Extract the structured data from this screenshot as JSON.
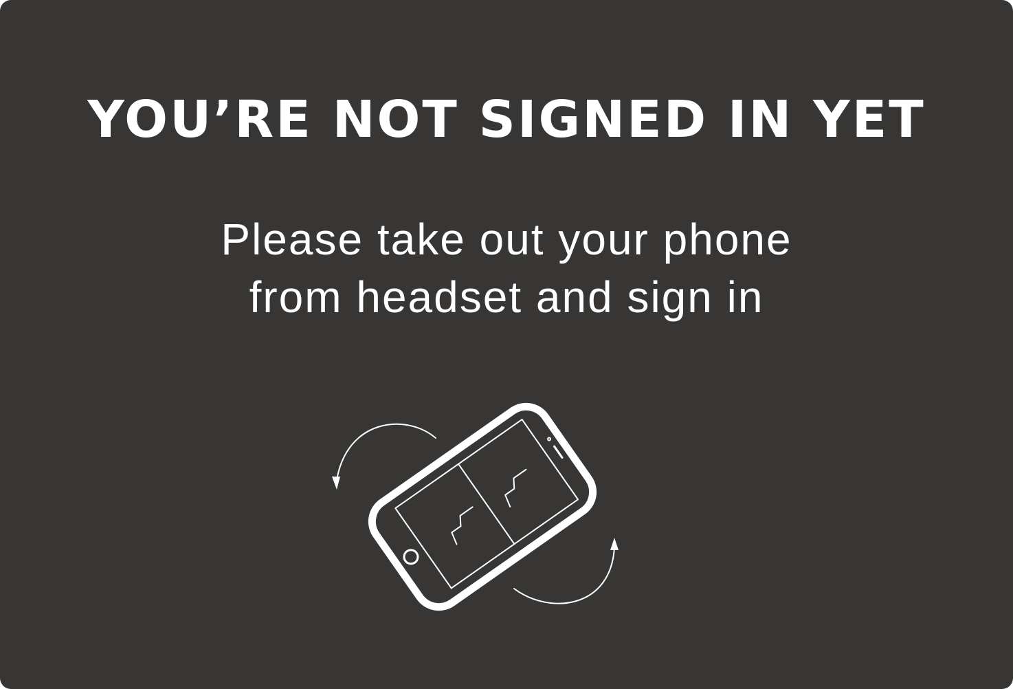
{
  "dialog": {
    "title": "YOU’RE NOT SIGNED IN YET",
    "message_lines": [
      "Please take out your phone",
      "from headset and sign in"
    ]
  },
  "illustration": {
    "icon": "rotate-phone-icon",
    "stroke_color": "#ffffff"
  },
  "colors": {
    "background": "#373634",
    "text": "#ffffff"
  }
}
